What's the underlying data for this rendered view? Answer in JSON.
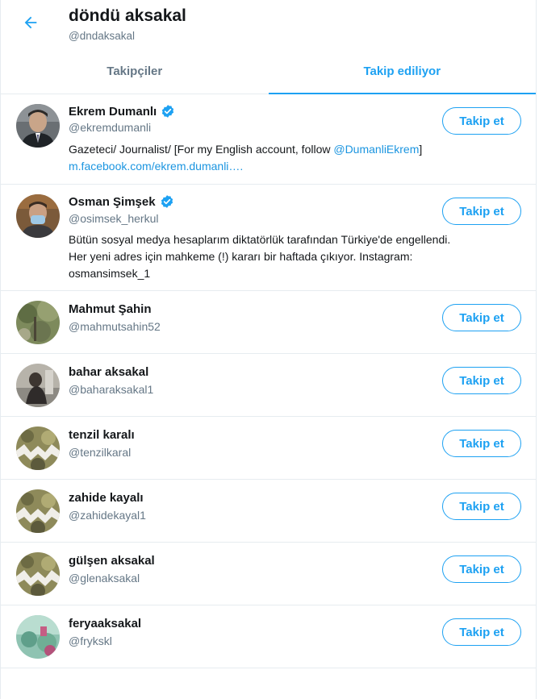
{
  "header": {
    "title": "döndü aksakal",
    "handle": "@dndaksakal",
    "back_icon": "arrow-left-icon"
  },
  "tabs": [
    {
      "label": "Takipçiler",
      "active": false
    },
    {
      "label": "Takip ediliyor",
      "active": true
    }
  ],
  "colors": {
    "accent": "#1da1f2",
    "link": "#1b95e0",
    "secondary_text": "#657786",
    "divider": "#e6ecf0"
  },
  "users": [
    {
      "name": "Ekrem Dumanlı",
      "verified": true,
      "handle": "@ekremdumanli",
      "follow_label": "Takip et",
      "bio_line1_pre": "Gazeteci/ Journalist/ [For my English account, follow ",
      "bio_line1_link": "@DumanliEkrem",
      "bio_line1_post": "]",
      "bio_line2_link": "m.facebook.com/ekrem.dumanli…."
    },
    {
      "name": "Osman Şimşek",
      "verified": true,
      "handle": "@osimsek_herkul",
      "follow_label": "Takip et",
      "bio_line1": "Bütün sosyal medya hesaplarım diktatörlük tarafından Türkiye'de engellendi.",
      "bio_line2": "Her yeni adres için mahkeme (!) kararı bir haftada çıkıyor. Instagram:",
      "bio_line3": "osmansimsek_1"
    },
    {
      "name": "Mahmut Şahin",
      "verified": false,
      "handle": "@mahmutsahin52",
      "follow_label": "Takip et"
    },
    {
      "name": "bahar aksakal",
      "verified": false,
      "handle": "@baharaksakal1",
      "follow_label": "Takip et"
    },
    {
      "name": "tenzil karalı",
      "verified": false,
      "handle": "@tenzilkaral",
      "follow_label": "Takip et"
    },
    {
      "name": "zahide kayalı",
      "verified": false,
      "handle": "@zahidekayal1",
      "follow_label": "Takip et"
    },
    {
      "name": "gülşen aksakal",
      "verified": false,
      "handle": "@glenaksakal",
      "follow_label": "Takip et"
    },
    {
      "name": "feryaaksakal",
      "verified": false,
      "handle": "@frykskl",
      "follow_label": "Takip et"
    }
  ]
}
